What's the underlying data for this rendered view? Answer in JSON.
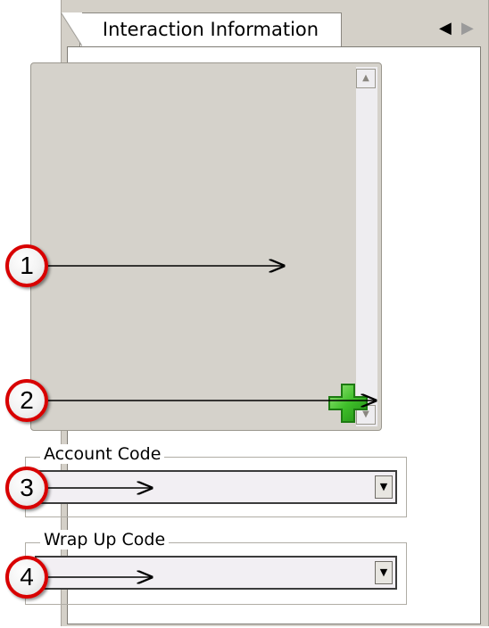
{
  "tab": {
    "label": "Interaction Information",
    "prev_icon": "triangle-left-icon",
    "next_icon": "triangle-right-icon"
  },
  "info_area": {
    "add_icon": "green-plus-icon"
  },
  "account_code": {
    "label": "Account Code",
    "value": ""
  },
  "wrap_up_code": {
    "label": "Wrap Up Code",
    "value": ""
  },
  "callouts": [
    "1",
    "2",
    "3",
    "4"
  ],
  "colors": {
    "panel": "#d4d0c8",
    "info_area": "#d5d2cb",
    "callout_ring": "#d80000",
    "add_icon": "#3fbf2a"
  }
}
